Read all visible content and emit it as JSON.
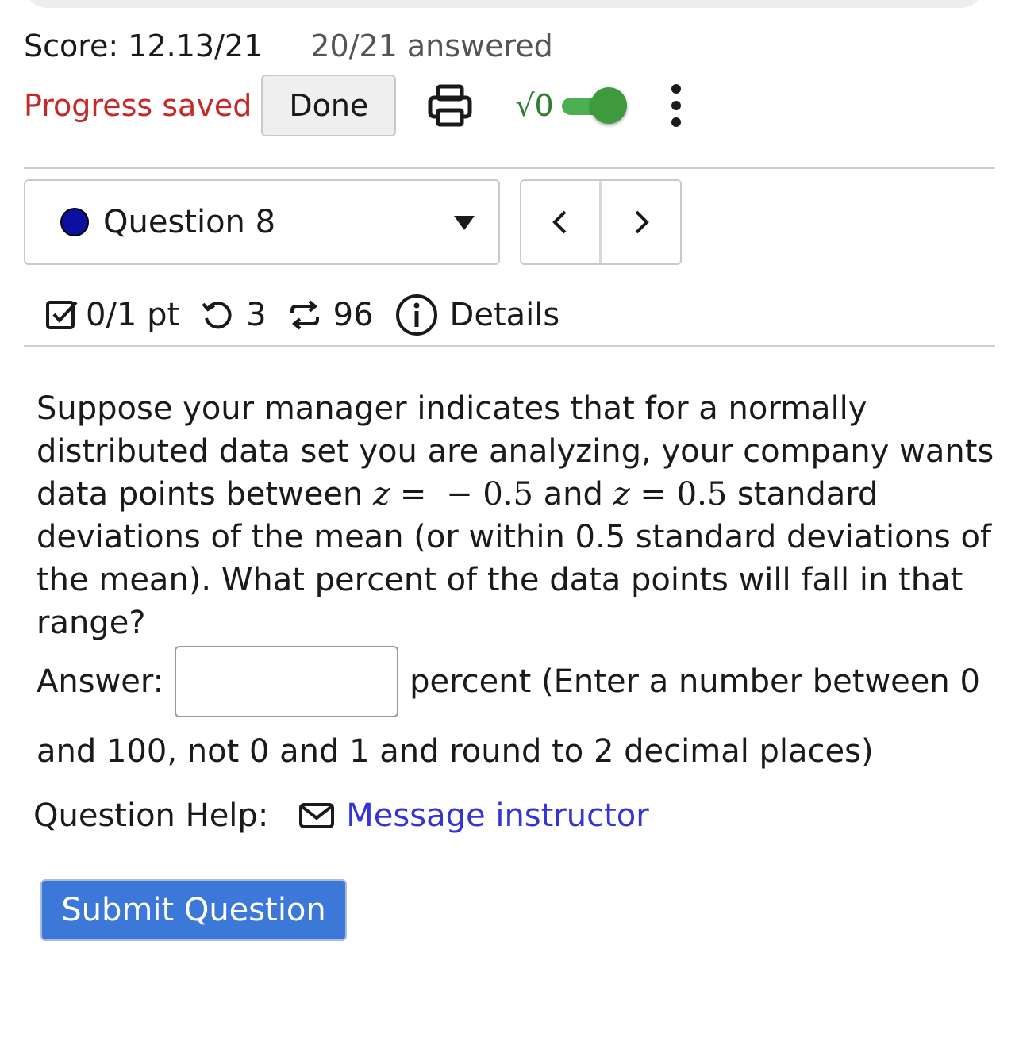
{
  "header": {
    "score": "Score: 12.13/21",
    "answered": "20/21 answered",
    "progress_status": "Progress saved",
    "done_label": "Done",
    "print_icon": "printer-icon",
    "math_toggle_label": "√0",
    "math_toggle_on": true,
    "more_icon": "vertical-ellipsis-icon"
  },
  "question_nav": {
    "selected": "Question 8",
    "status_color": "#0b0fa0",
    "prev_icon": "chevron-left-icon",
    "next_icon": "chevron-right-icon"
  },
  "question_meta": {
    "points": "0/1 pt",
    "retries": "3",
    "attempts": "96",
    "details_label": "Details"
  },
  "question": {
    "part1": "Suppose your manager indicates that for a normally distributed data set you are analyzing, your company wants data points between ",
    "z_var": "z",
    "eq": " = ",
    "z_low": "− 0.5",
    "and": " and ",
    "z_high": "0.5",
    "part2": " standard deviations of the mean (or within 0.5 standard deviations of the mean). What percent of the data points will fall in that range?"
  },
  "answer": {
    "label": "Answer:",
    "value": "",
    "suffix": "percent (Enter a number between 0",
    "suffix_line2": "and 100, not 0 and 1 and round to 2 decimal places)"
  },
  "help": {
    "label": "Question Help:",
    "link": "Message instructor"
  },
  "submit_label": "Submit Question",
  "colors": {
    "progress_saved": "#c62828",
    "toggle_on": "#4caf50",
    "link": "#3535d6",
    "submit": "#3c78d8"
  }
}
